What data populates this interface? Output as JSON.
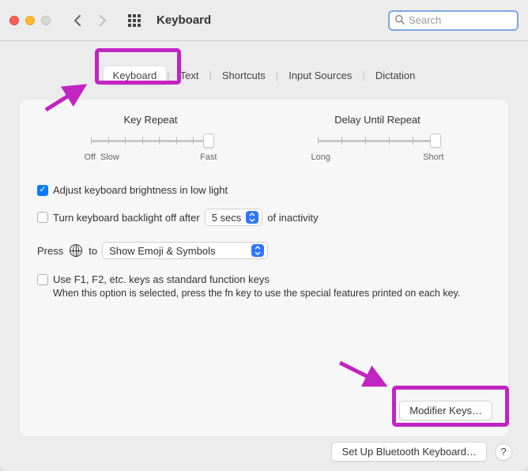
{
  "window": {
    "title": "Keyboard"
  },
  "search": {
    "placeholder": "Search"
  },
  "tabs": {
    "items": [
      "Keyboard",
      "Text",
      "Shortcuts",
      "Input Sources",
      "Dictation"
    ],
    "selected_index": 0
  },
  "sliders": {
    "keyRepeat": {
      "label": "Key Repeat",
      "leftLabel": "Off",
      "secondLabel": "Slow",
      "rightLabel": "Fast"
    },
    "delay": {
      "label": "Delay Until Repeat",
      "leftLabel": "Long",
      "rightLabel": "Short"
    }
  },
  "options": {
    "adjustBrightness": {
      "label": "Adjust keyboard brightness in low light",
      "checked": true
    },
    "backlightOff": {
      "prefix": "Turn keyboard backlight off after",
      "value": "5 secs",
      "suffix": "of inactivity",
      "checked": false
    },
    "globe": {
      "prefix": "Press",
      "mid": "to",
      "value": "Show Emoji & Symbols"
    },
    "fnKeys": {
      "label": "Use F1, F2, etc. keys as standard function keys",
      "checked": false,
      "description": "When this option is selected, press the fn key to use the special features printed on each key."
    }
  },
  "buttons": {
    "modifier": "Modifier Keys…",
    "bluetooth": "Set Up Bluetooth Keyboard…",
    "help": "?"
  }
}
